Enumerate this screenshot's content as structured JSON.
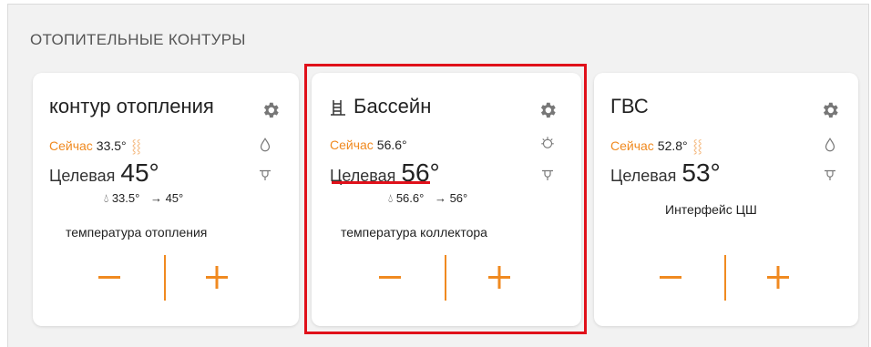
{
  "section": {
    "title": "ОТОПИТЕЛЬНЫЕ КОНТУРЫ"
  },
  "colors": {
    "accent": "#f08a20",
    "highlight": "#e0101a"
  },
  "cards": [
    {
      "title": "контур отопления",
      "now_label": "Сейчас",
      "now_value": "33.5°",
      "target_label": "Целевая",
      "target_value": "45°",
      "sub_current": "33.5°",
      "sub_arrow": "→ 45°",
      "caption": "температура отопления",
      "minus": "−",
      "plus": "+"
    },
    {
      "title": "Бассейн",
      "now_label": "Сейчас",
      "now_value": "56.6°",
      "target_label": "Целевая",
      "target_value": "56°",
      "sub_current": "56.6°",
      "sub_arrow": "→ 56°",
      "caption": "температура коллектора",
      "minus": "−",
      "plus": "+"
    },
    {
      "title": "ГВС",
      "now_label": "Сейчас",
      "now_value": "52.8°",
      "target_label": "Целевая",
      "target_value": "53°",
      "caption": "Интерфейс ЦШ",
      "minus": "−",
      "plus": "+"
    }
  ]
}
